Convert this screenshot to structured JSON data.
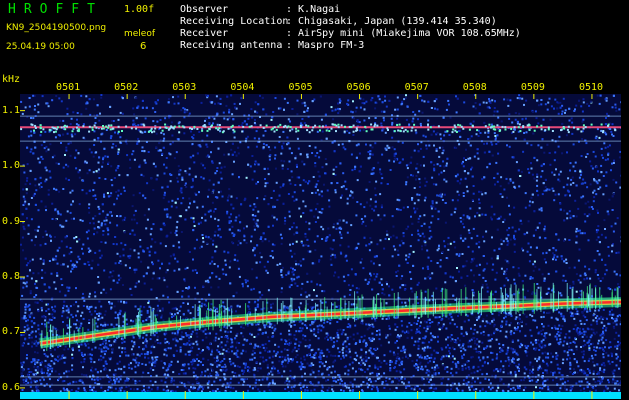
{
  "header": {
    "app_title": "HROFFT",
    "version": "1.00f",
    "filename": "KN9_2504190500.png",
    "meleof_label": "meleof",
    "meleof_value": "6",
    "datetime": "25.04.19 05:00",
    "info": [
      {
        "label": "Observer",
        "value": ": K.Nagai"
      },
      {
        "label": "Receiving Location",
        "value": ": Chigasaki, Japan (139.414 35.340)"
      },
      {
        "label": "Receiver",
        "value": ": AirSpy mini (Miakejima VOR 108.65MHz)"
      },
      {
        "label": "Receiving antenna",
        "value": ": Maspro FM-3"
      }
    ]
  },
  "chart_data": {
    "type": "heatmap",
    "ylabel": "kHz",
    "x_ticks": [
      "0501",
      "0502",
      "0503",
      "0504",
      "0505",
      "0506",
      "0507",
      "0508",
      "0509",
      "0510"
    ],
    "y_ticks": [
      "1.1",
      "1.0",
      "0.9",
      "0.8",
      "0.7",
      "0.6"
    ],
    "ylim": [
      0.58,
      1.13
    ],
    "carrier_lines_khz": [
      1.09,
      1.07,
      1.045,
      0.76,
      0.62,
      0.605
    ],
    "drift_trace": {
      "x_minutes": [
        0,
        1,
        2,
        3,
        4,
        5,
        6,
        7,
        8,
        9,
        10
      ],
      "y_khz": [
        0.68,
        0.695,
        0.71,
        0.72,
        0.728,
        0.733,
        0.738,
        0.743,
        0.747,
        0.752,
        0.755
      ]
    },
    "colors": {
      "background": "#000",
      "noise_dark": "#0a1a78",
      "noise_mid": "#1a3fd0",
      "trace": "#ff2a2a",
      "carrier": "#9fd0ff",
      "tick": "#f0f000"
    }
  }
}
